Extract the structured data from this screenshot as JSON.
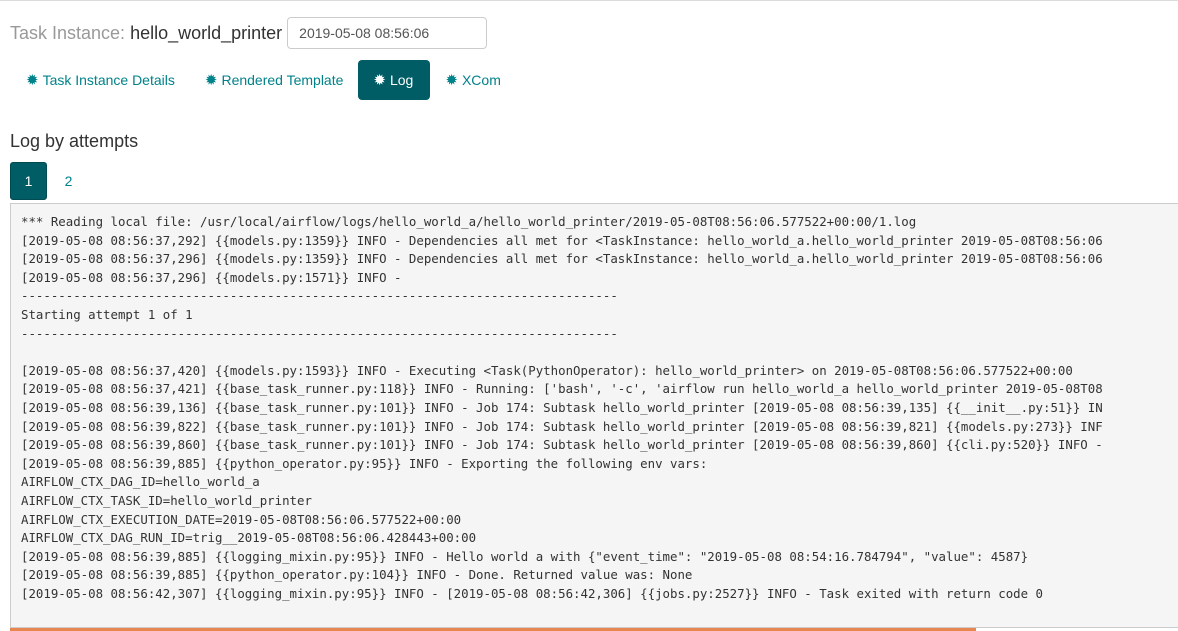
{
  "header": {
    "label": "Task Instance:",
    "task_name": "hello_world_printer",
    "execution_date": "2019-05-08 08:56:06"
  },
  "tabs": [
    {
      "label": "Task Instance Details",
      "active": false
    },
    {
      "label": "Rendered Template",
      "active": false
    },
    {
      "label": "Log",
      "active": true
    },
    {
      "label": "XCom",
      "active": false
    }
  ],
  "tab_icon": "✹",
  "log_section": {
    "title": "Log by attempts",
    "attempts": [
      "1",
      "2"
    ],
    "active_attempt": "1"
  },
  "colors": {
    "accent": "#005c65",
    "link": "#00828a",
    "bottom_bar": "#e8864f"
  },
  "log_lines": [
    "*** Reading local file: /usr/local/airflow/logs/hello_world_a/hello_world_printer/2019-05-08T08:56:06.577522+00:00/1.log",
    "[2019-05-08 08:56:37,292] {{models.py:1359}} INFO - Dependencies all met for <TaskInstance: hello_world_a.hello_world_printer 2019-05-08T08:56:06",
    "[2019-05-08 08:56:37,296] {{models.py:1359}} INFO - Dependencies all met for <TaskInstance: hello_world_a.hello_world_printer 2019-05-08T08:56:06",
    "[2019-05-08 08:56:37,296] {{models.py:1571}} INFO -",
    "--------------------------------------------------------------------------------",
    "Starting attempt 1 of 1",
    "--------------------------------------------------------------------------------",
    "",
    "[2019-05-08 08:56:37,420] {{models.py:1593}} INFO - Executing <Task(PythonOperator): hello_world_printer> on 2019-05-08T08:56:06.577522+00:00",
    "[2019-05-08 08:56:37,421] {{base_task_runner.py:118}} INFO - Running: ['bash', '-c', 'airflow run hello_world_a hello_world_printer 2019-05-08T08",
    "[2019-05-08 08:56:39,136] {{base_task_runner.py:101}} INFO - Job 174: Subtask hello_world_printer [2019-05-08 08:56:39,135] {{__init__.py:51}} IN",
    "[2019-05-08 08:56:39,822] {{base_task_runner.py:101}} INFO - Job 174: Subtask hello_world_printer [2019-05-08 08:56:39,821] {{models.py:273}} INF",
    "[2019-05-08 08:56:39,860] {{base_task_runner.py:101}} INFO - Job 174: Subtask hello_world_printer [2019-05-08 08:56:39,860] {{cli.py:520}} INFO -",
    "[2019-05-08 08:56:39,885] {{python_operator.py:95}} INFO - Exporting the following env vars:",
    "AIRFLOW_CTX_DAG_ID=hello_world_a",
    "AIRFLOW_CTX_TASK_ID=hello_world_printer",
    "AIRFLOW_CTX_EXECUTION_DATE=2019-05-08T08:56:06.577522+00:00",
    "AIRFLOW_CTX_DAG_RUN_ID=trig__2019-05-08T08:56:06.428443+00:00",
    "[2019-05-08 08:56:39,885] {{logging_mixin.py:95}} INFO - Hello world a with {\"event_time\": \"2019-05-08 08:54:16.784794\", \"value\": 4587}",
    "[2019-05-08 08:56:39,885] {{python_operator.py:104}} INFO - Done. Returned value was: None",
    "[2019-05-08 08:56:42,307] {{logging_mixin.py:95}} INFO - [2019-05-08 08:56:42,306] {{jobs.py:2527}} INFO - Task exited with return code 0"
  ]
}
